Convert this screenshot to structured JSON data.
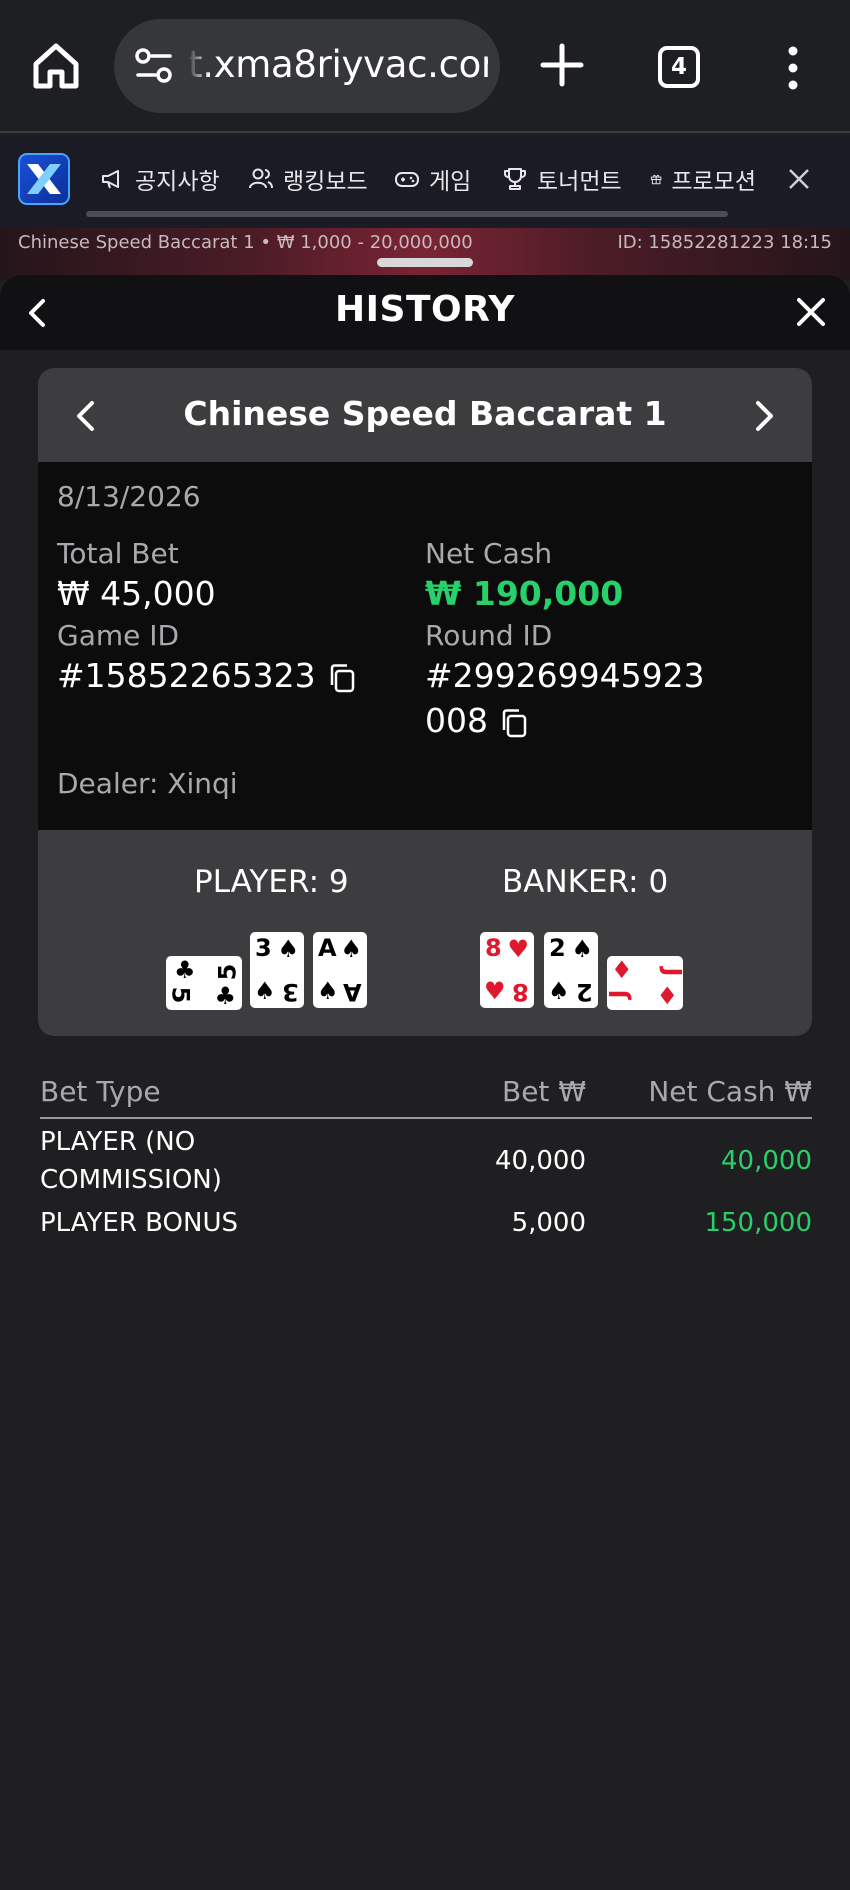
{
  "browser": {
    "url": "t.xma8riyvac.com",
    "tab_count": "4"
  },
  "site_nav": {
    "items": [
      {
        "label": "공지사항",
        "icon": "megaphone-icon"
      },
      {
        "label": "랭킹보드",
        "icon": "users-icon"
      },
      {
        "label": "게임",
        "icon": "gamepad-icon"
      },
      {
        "label": "토너먼트",
        "icon": "trophy-icon"
      },
      {
        "label": "프로모션",
        "icon": "gift-icon"
      }
    ]
  },
  "game_strip": {
    "name": "Chinese Speed Baccarat 1 • ₩ 1,000 - 20,000,000",
    "id": "ID: 15852281223 18:15"
  },
  "history": {
    "title": "HISTORY",
    "game_title": "Chinese Speed Baccarat 1",
    "date": "8/13/2026",
    "total_bet_label": "Total Bet",
    "total_bet": "₩ 45,000",
    "net_cash_label": "Net Cash",
    "net_cash": "₩ 190,000",
    "game_id_label": "Game ID",
    "game_id": "#15852265323",
    "round_id_label": "Round ID",
    "round_id_line1": "#299269945923",
    "round_id_line2": "008",
    "dealer": "Dealer: Xinqi",
    "player_label": "PLAYER: 9",
    "banker_label": "BANKER: 0",
    "player_cards": [
      {
        "rank": "5",
        "suit": "♣",
        "color": "black",
        "rotated": true
      },
      {
        "rank": "3",
        "suit": "♠",
        "color": "black",
        "rotated": false
      },
      {
        "rank": "A",
        "suit": "♠",
        "color": "black",
        "rotated": false
      }
    ],
    "banker_cards": [
      {
        "rank": "8",
        "suit": "♥",
        "color": "red",
        "rotated": false
      },
      {
        "rank": "2",
        "suit": "♠",
        "color": "black",
        "rotated": false
      },
      {
        "rank": "J",
        "suit": "♦",
        "color": "red",
        "rotated": true
      }
    ]
  },
  "bets": {
    "headers": {
      "type": "Bet Type",
      "bet": "Bet ₩",
      "net": "Net Cash ₩"
    },
    "rows": [
      {
        "type_line1": "PLAYER (NO",
        "type_line2": "COMMISSION)",
        "bet": "40,000",
        "net": "40,000"
      },
      {
        "type_line1": "PLAYER BONUS",
        "type_line2": "",
        "bet": "5,000",
        "net": "150,000"
      }
    ]
  },
  "colors": {
    "positive": "#27d06a",
    "panel": "#3d3c3e",
    "background": "#1f1f21"
  }
}
